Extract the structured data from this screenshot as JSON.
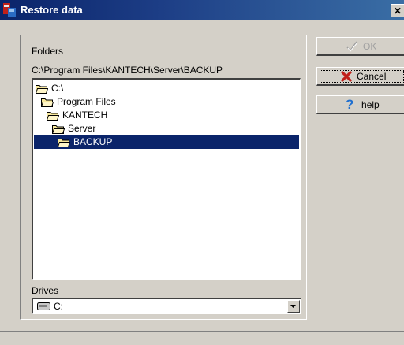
{
  "window": {
    "title": "Restore data"
  },
  "folders": {
    "label": "Folders",
    "current_path": "C:\\Program Files\\KANTECH\\Server\\BACKUP",
    "tree": [
      {
        "label": "C:\\",
        "selected": false
      },
      {
        "label": "Program Files",
        "selected": false
      },
      {
        "label": "KANTECH",
        "selected": false
      },
      {
        "label": "Server",
        "selected": false
      },
      {
        "label": "BACKUP",
        "selected": true
      }
    ]
  },
  "drives": {
    "label": "Drives",
    "selected": "C:"
  },
  "buttons": {
    "ok": "OK",
    "cancel": "Cancel",
    "help": "help"
  },
  "icons": {
    "ok": "check-icon",
    "cancel": "x-icon",
    "help": "question-icon",
    "folder": "folder-icon",
    "drive": "drive-icon"
  },
  "colors": {
    "titlebar": "#0a246a",
    "selection": "#0a246a",
    "cancel_icon": "#c0201a",
    "help_icon": "#1f6fd0"
  }
}
